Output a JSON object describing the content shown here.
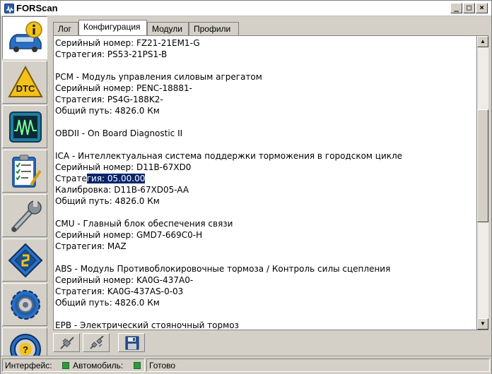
{
  "window": {
    "title": "FORScan",
    "minimize_label": "_",
    "maximize_label": "□",
    "close_label": "×"
  },
  "sidebar": {
    "items": [
      {
        "name": "vehicle-info",
        "icon": "car-info-icon",
        "active": true
      },
      {
        "name": "dtc",
        "icon": "dtc-icon",
        "label": "DTC"
      },
      {
        "name": "oscilloscope",
        "icon": "oscilloscope-icon"
      },
      {
        "name": "checklist",
        "icon": "checklist-icon"
      },
      {
        "name": "service",
        "icon": "wrench-icon"
      },
      {
        "name": "chip",
        "icon": "chip-icon"
      },
      {
        "name": "settings",
        "icon": "gear-icon"
      },
      {
        "name": "help",
        "icon": "help-icon"
      }
    ],
    "dtc_label": "DTC"
  },
  "tabs": [
    {
      "label": "Лог",
      "active": false
    },
    {
      "label": "Конфигурация",
      "active": true
    },
    {
      "label": "Модули",
      "active": false
    },
    {
      "label": "Профили",
      "active": false
    }
  ],
  "content": {
    "lines": [
      "Серийный номер: FZ21-21EM1-G",
      "Стратегия: PS53-21PS1-B",
      "",
      "PCM - Модуль управления силовым агрегатом",
      "Серийный номер: PENC-18881-",
      "Стратегия: PS4G-188K2-",
      "Общий путь: 4826.0 Км",
      "",
      "OBDII - On Board Diagnostic II",
      "",
      "ICA - Интеллектуальная система поддержки торможения в городском цикле",
      "Серийный номер: D11B-67XD0",
      "",
      "Калибровка: D11B-67XD05-AA",
      "Общий путь: 4826.0 Км",
      "",
      "CMU - Главный блок обеспечения связи",
      "Серийный номер: GMD7-669C0-H",
      "Стратегия: MAZ",
      "",
      "ABS - Модуль Противоблокировочные тормоза / Контроль силы сцепления",
      "Серийный номер: KA0G-437A0-",
      "Стратегия: KA0G-437AS-0-03",
      "Общий путь: 4826.0 Км",
      "",
      "EPB - Электрический стояночный тормоз"
    ],
    "selected_line": {
      "before": "Страте",
      "selected": "гия: 05.00.00"
    }
  },
  "toolbar": {
    "connect": "connect-icon",
    "disconnect": "disconnect-icon",
    "save": "save-icon"
  },
  "status": {
    "interface_label": "Интерфейс:",
    "vehicle_label": "Автомобиль:",
    "state": "Готово",
    "led_color": "#2f9a3a"
  },
  "colors": {
    "selection": "#0a246a",
    "chrome": "#d4d0c8"
  }
}
